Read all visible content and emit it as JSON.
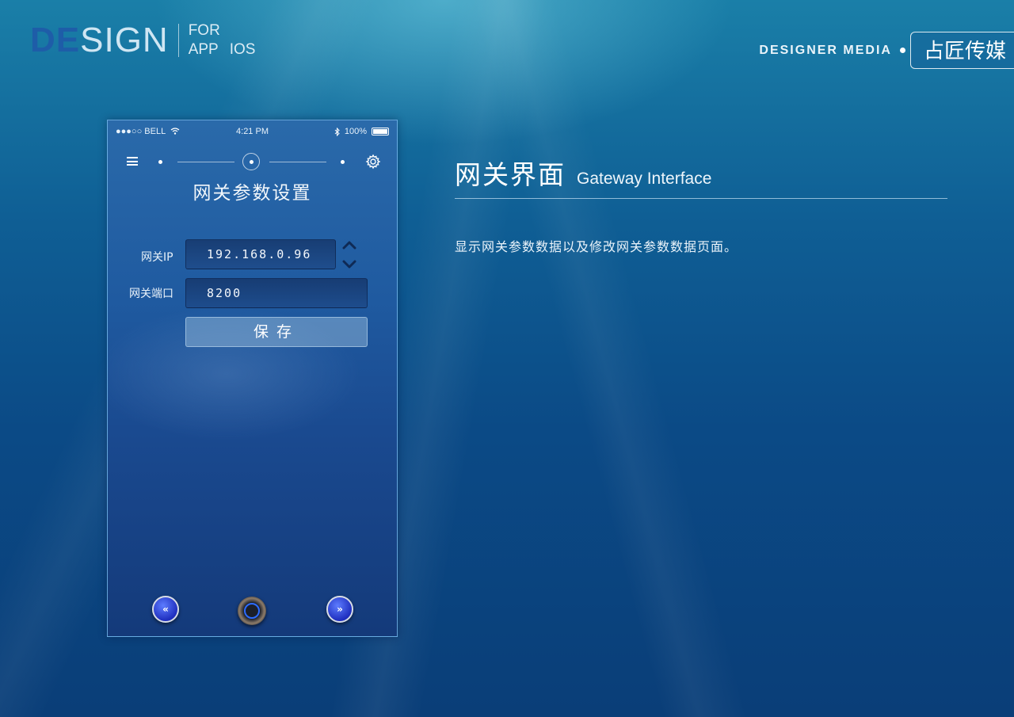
{
  "brand": {
    "de": "DE",
    "sign": "SIGN",
    "for": "FOR",
    "app": "APP",
    "ios": "IOS"
  },
  "media": {
    "label": "DESIGNER MEDIA",
    "cn_logo": "占匠传媒"
  },
  "phone": {
    "status": {
      "carrier": "●●●○○ BELL",
      "time": "4:21 PM",
      "battery": "100%"
    },
    "icons": {
      "menu": "hamburger-icon",
      "settings": "gear-icon",
      "wifi": "wifi-icon",
      "bluetooth": "bluetooth-icon"
    },
    "title": "网关参数设置",
    "fields": [
      {
        "label": "网关IP",
        "value": "192.168.0.96"
      },
      {
        "label": "网关端口",
        "value": "8200"
      }
    ],
    "save_label": "保存",
    "bottom": {
      "prev": "«",
      "next": "»"
    }
  },
  "section": {
    "title_cn": "网关界面",
    "title_en": "Gateway Interface",
    "description": "显示网关参数数据以及修改网关参数数据页面。"
  },
  "colors": {
    "accent": "#1e5da8",
    "button_blue": "#2d3fe0"
  }
}
